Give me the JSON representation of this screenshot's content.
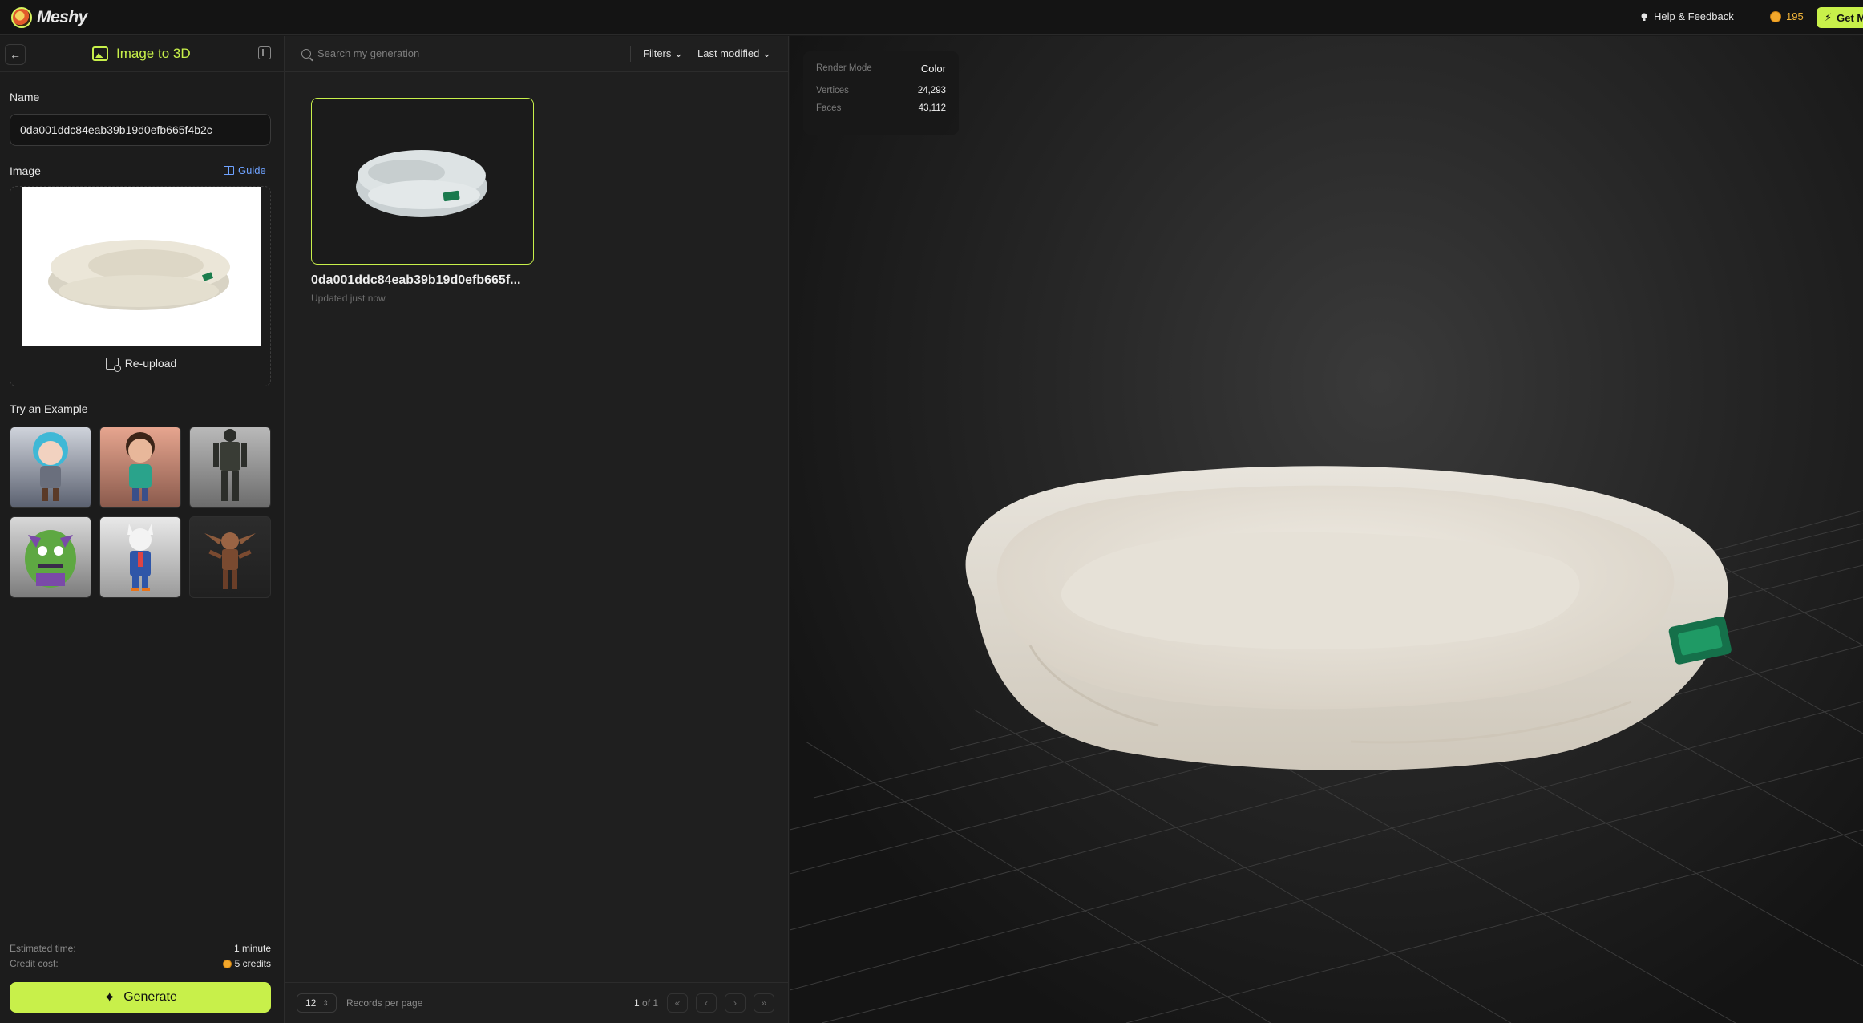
{
  "app": {
    "logo_text": "Meshy"
  },
  "topbar": {
    "help_label": "Help & Feedback",
    "credits": "195",
    "get_label": "Get M"
  },
  "left_panel": {
    "title": "Image to 3D",
    "name_label": "Name",
    "name_value": "0da001ddc84eab39b19d0efb665f4b2c",
    "image_label": "Image",
    "guide_label": "Guide",
    "reupload_label": "Re-upload",
    "examples_label": "Try an Example",
    "examples": [
      {
        "name": "blue-haired-chibi"
      },
      {
        "name": "boy-green-jacket"
      },
      {
        "name": "armored-robot"
      },
      {
        "name": "green-horned-monster"
      },
      {
        "name": "fox-blue-suit"
      },
      {
        "name": "goblin-creature"
      }
    ],
    "estimated_time_label": "Estimated time:",
    "estimated_time_value": "1 minute",
    "credit_cost_label": "Credit cost:",
    "credit_cost_value": "5 credits",
    "generate_label": "Generate"
  },
  "middle_panel": {
    "search_placeholder": "Search my generation",
    "filters_label": "Filters",
    "sort_label": "Last modified",
    "card_title": "0da001ddc84eab39b19d0efb665f...",
    "card_subtitle": "Updated just now",
    "per_page_value": "12",
    "per_page_label": "Records per page",
    "page_current": "1",
    "page_total_text": "of 1"
  },
  "viewer": {
    "render_mode_label": "Render Mode",
    "render_mode_value": "Color",
    "vertices_label": "Vertices",
    "vertices_value": "24,293",
    "faces_label": "Faces",
    "faces_value": "43,112"
  },
  "colors": {
    "accent": "#c8f04a",
    "link": "#6ea2ff",
    "coin": "#f4a82b",
    "background": "#1a1a1a"
  }
}
